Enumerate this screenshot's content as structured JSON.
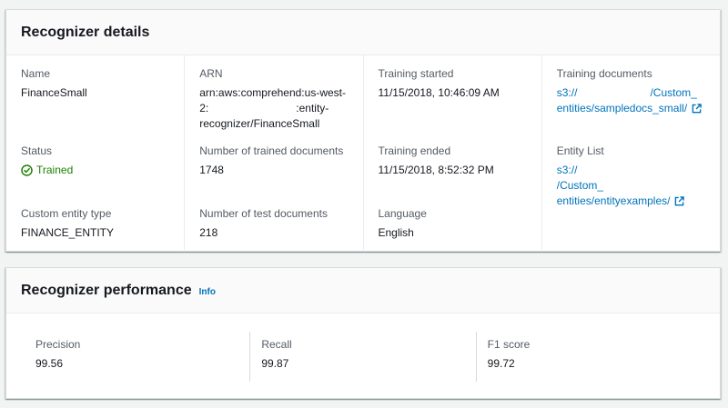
{
  "details": {
    "title": "Recognizer details",
    "name_label": "Name",
    "name_value": "FinanceSmall",
    "arn_label": "ARN",
    "arn_line1": "arn:aws:comprehend:us-west-",
    "arn_line2_pre": "2:",
    "arn_line2_post": ":entity-",
    "arn_line3": "recognizer/FinanceSmall",
    "training_started_label": "Training started",
    "training_started_value": "11/15/2018, 10:46:09 AM",
    "training_docs_label": "Training documents",
    "training_docs_line1_pre": "s3://",
    "training_docs_line1_post": "/Custom_",
    "training_docs_line2": "entities/sampledocs_small/",
    "status_label": "Status",
    "status_value": "Trained",
    "num_trained_label": "Number of trained documents",
    "num_trained_value": "1748",
    "training_ended_label": "Training ended",
    "training_ended_value": "11/15/2018, 8:52:32 PM",
    "entity_list_label": "Entity List",
    "entity_list_line1_pre": "s3://",
    "entity_list_line1_post": "/Custom_",
    "entity_list_line2": "entities/entityexamples/",
    "custom_type_label": "Custom entity type",
    "custom_type_value": "FINANCE_ENTITY",
    "num_test_label": "Number of test documents",
    "num_test_value": "218",
    "language_label": "Language",
    "language_value": "English"
  },
  "performance": {
    "title": "Recognizer performance",
    "info_label": "Info",
    "precision_label": "Precision",
    "precision_value": "99.56",
    "recall_label": "Recall",
    "recall_value": "99.87",
    "f1_label": "F1 score",
    "f1_value": "99.72"
  },
  "colors": {
    "link": "#0073bb",
    "success": "#1d8102",
    "label": "#545b64",
    "text": "#16191f"
  },
  "icons": {
    "status": "check-circle-icon",
    "external": "external-link-icon"
  }
}
